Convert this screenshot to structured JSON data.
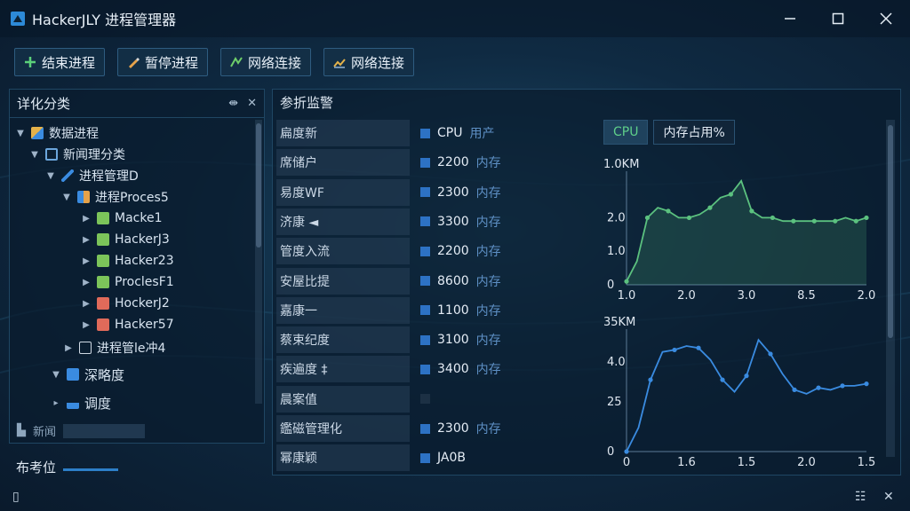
{
  "window": {
    "title": "HackerJLY 进程管理器"
  },
  "toolbar": {
    "buttons": [
      {
        "label": "结束进程",
        "icon": "plus-icon"
      },
      {
        "label": "暂停进程",
        "icon": "pencil-icon"
      },
      {
        "label": "网络连接",
        "icon": "network-icon"
      },
      {
        "label": "网络连接",
        "icon": "network-chart-icon"
      }
    ]
  },
  "left_panel": {
    "title": "详化分类",
    "tree": [
      {
        "label": "数据进程",
        "expanded": true
      },
      {
        "label": "新闻理分类",
        "expanded": true
      },
      {
        "label": "进程管理D",
        "expanded": true
      },
      {
        "label": "进程Proces5",
        "expanded": true
      },
      {
        "label": "Macke1"
      },
      {
        "label": "HackerJ3"
      },
      {
        "label": "Hacker23"
      },
      {
        "label": "ProclesF1"
      },
      {
        "label": "HockerJ2"
      },
      {
        "label": "Hacker57"
      },
      {
        "label": "进程管le冲4"
      },
      {
        "label": "深略度"
      },
      {
        "label": "调度"
      }
    ],
    "footer_label": "新闻"
  },
  "status_left": "布考位",
  "details": {
    "title": "参折监警",
    "rows": [
      {
        "name": "扁度新",
        "value": "CPU",
        "unit": "用产"
      },
      {
        "name": "席储户",
        "value": "2200",
        "unit": "内存"
      },
      {
        "name": "易度WF",
        "value": "2300",
        "unit": "内存"
      },
      {
        "name": "济康 ◄",
        "value": "3300",
        "unit": "内存"
      },
      {
        "name": "管度入流",
        "value": "2200",
        "unit": "内存"
      },
      {
        "name": "安屋比提",
        "value": "8600",
        "unit": "内存"
      },
      {
        "name": "嘉康一",
        "value": "1100",
        "unit": "内存"
      },
      {
        "name": "蔡束纪度",
        "value": "3100",
        "unit": "内存"
      },
      {
        "name": "疾遍度 ‡",
        "value": "3400",
        "unit": "内存"
      },
      {
        "name": "晨案值",
        "value": "",
        "unit": ""
      },
      {
        "name": "鑑磁管理化",
        "value": "2300",
        "unit": "内存"
      },
      {
        "name": "幂康颖",
        "value": "JA0B",
        "unit": ""
      }
    ]
  },
  "chart_tabs": [
    "CPU",
    "内存占用%"
  ],
  "colors": {
    "cpu_line": "#5bc17f",
    "mem_line": "#3a8be0",
    "accent": "#2d72c4"
  },
  "chart_data": [
    {
      "type": "area",
      "title": "1.0KM",
      "x_ticks": [
        "1.0",
        "2.0",
        "3.0",
        "8.5",
        "2.0"
      ],
      "y_ticks": [
        "0",
        "1.0",
        "2.0"
      ],
      "series": [
        {
          "values": [
            0.1,
            0.7,
            2.0,
            2.3,
            2.2,
            2.0,
            2.0,
            2.1,
            2.3,
            2.6,
            2.7,
            3.1,
            2.2,
            2.0,
            2.0,
            1.9,
            1.9,
            1.9,
            1.9,
            1.9,
            1.9,
            2.0,
            1.9,
            2.0
          ]
        }
      ]
    },
    {
      "type": "line",
      "title": "35KM",
      "x_ticks": [
        "0",
        "1.6",
        "1.5",
        "2.0",
        "1.5"
      ],
      "y_ticks": [
        "0",
        "25",
        "4.0"
      ],
      "series": [
        {
          "values": [
            0.0,
            1.2,
            3.6,
            5.0,
            5.1,
            5.3,
            5.2,
            4.6,
            3.6,
            3.0,
            3.8,
            5.6,
            4.9,
            3.9,
            3.1,
            2.9,
            3.2,
            3.1,
            3.3,
            3.3,
            3.4
          ]
        }
      ]
    }
  ],
  "bottom_icons": [
    "book-icon",
    "settings-icon",
    "pin-icon"
  ]
}
